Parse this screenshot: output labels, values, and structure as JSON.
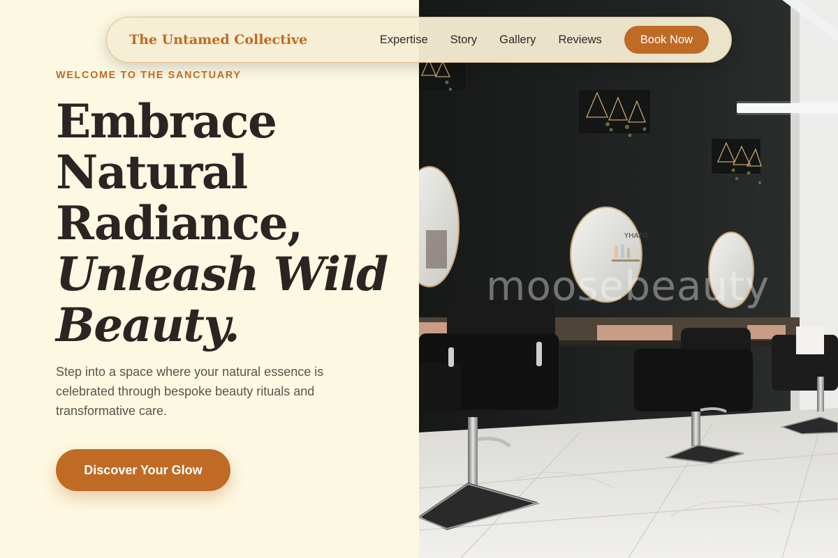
{
  "brand": "The Untamed Collective",
  "nav": {
    "links": [
      "Expertise",
      "Story",
      "Gallery",
      "Reviews"
    ],
    "book_label": "Book Now"
  },
  "hero": {
    "eyebrow": "WELCOME TO THE SANCTUARY",
    "headline_lines": [
      "Embrace",
      "Natural",
      "Radiance,"
    ],
    "headline_italic_lines": [
      "Unleash Wild",
      "Beauty."
    ],
    "subtext": "Step into a space where your natural essence is celebrated through bespoke beauty rituals and transformative care.",
    "cta_label": "Discover Your Glow"
  },
  "photo": {
    "watermark": "moosebeauty",
    "mirror_label": "YHAFO"
  },
  "colors": {
    "background": "#fdf8e2",
    "accent": "#bf6a25",
    "text": "#2a2522",
    "muted_text": "#5b534d"
  }
}
